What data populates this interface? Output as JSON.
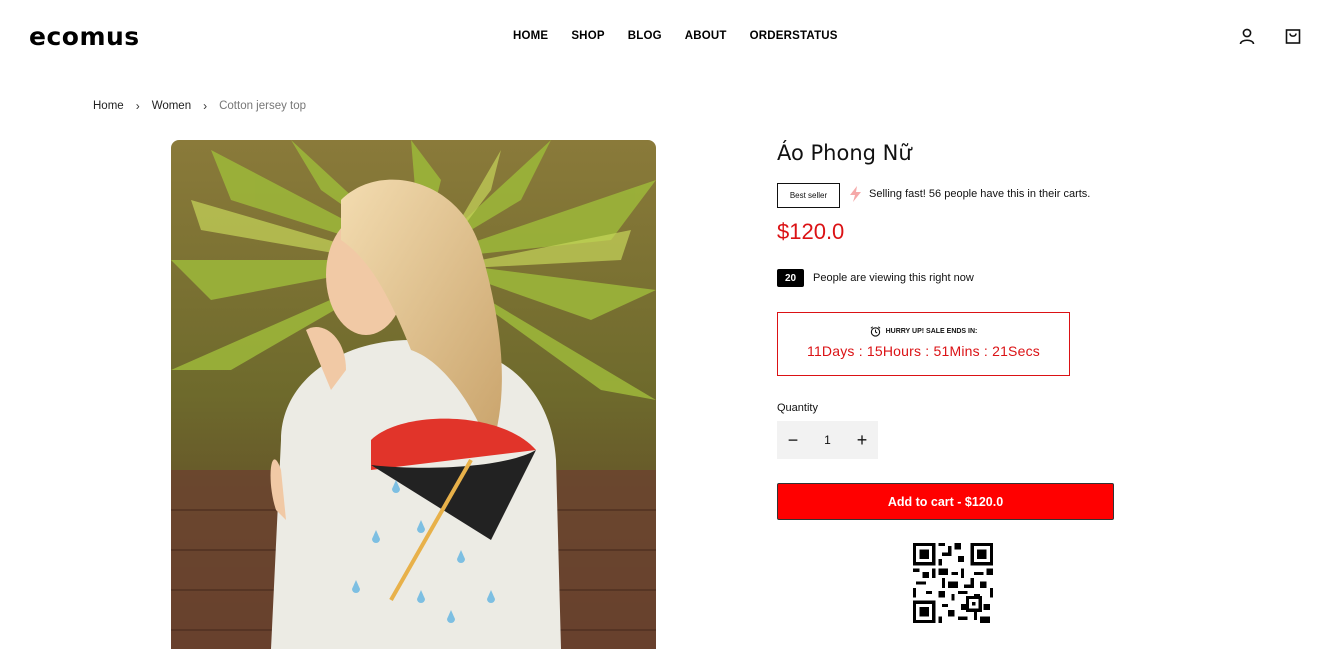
{
  "header": {
    "logo": "ecomus",
    "nav": [
      "HOME",
      "SHOP",
      "BLOG",
      "ABOUT",
      "ORDERSTATUS"
    ],
    "icons": [
      "user-icon",
      "cart-icon"
    ]
  },
  "breadcrumb": {
    "items": [
      "Home",
      "Women",
      "Cotton jersey top"
    ],
    "separator": "›"
  },
  "product": {
    "title": "Áo Phong Nữ",
    "badge": "Best seller",
    "selling_fast": "Selling fast! 56 people have this in their carts.",
    "price": "$120.0",
    "viewers_count": "20",
    "viewers_text": "People are viewing this right now",
    "countdown_label": "HURRY UP! SALE ENDS IN:",
    "countdown_time": "11Days : 15Hours : 51Mins : 21Secs",
    "quantity_label": "Quantity",
    "quantity_value": "1",
    "minus": "−",
    "plus": "+",
    "add_to_cart": "Add to cart - $120.0"
  },
  "colors": {
    "accent": "#db1215",
    "button": "#ff0000"
  }
}
